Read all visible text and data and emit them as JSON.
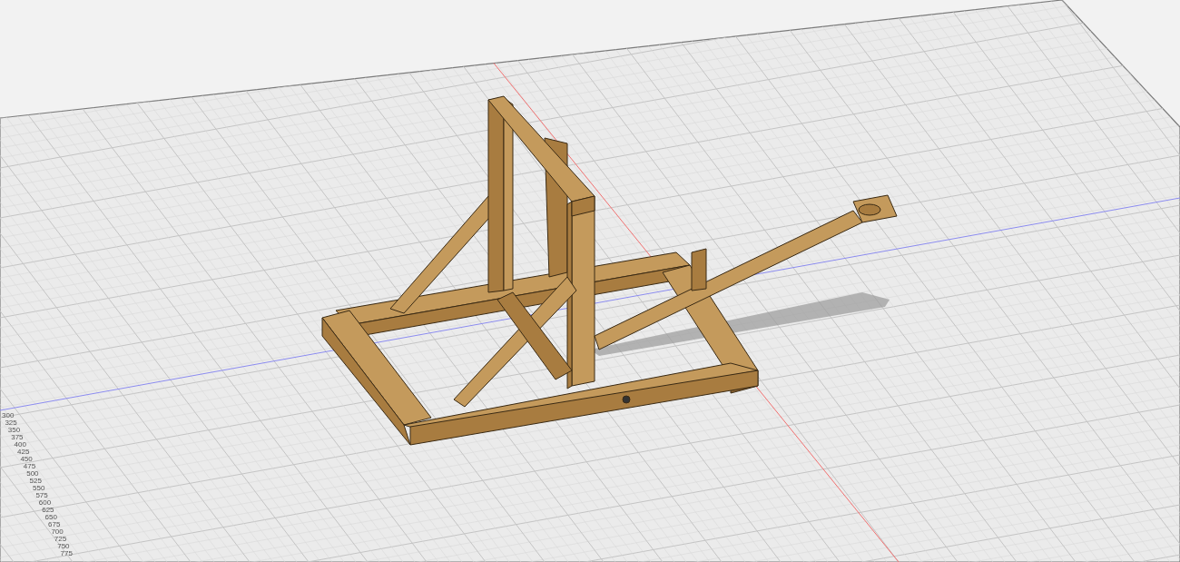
{
  "ruler": {
    "labels": [
      "300",
      "325",
      "350",
      "375",
      "400",
      "425",
      "450",
      "475",
      "500",
      "525",
      "550",
      "575",
      "600",
      "625",
      "650",
      "675",
      "700",
      "725",
      "750",
      "775"
    ]
  }
}
